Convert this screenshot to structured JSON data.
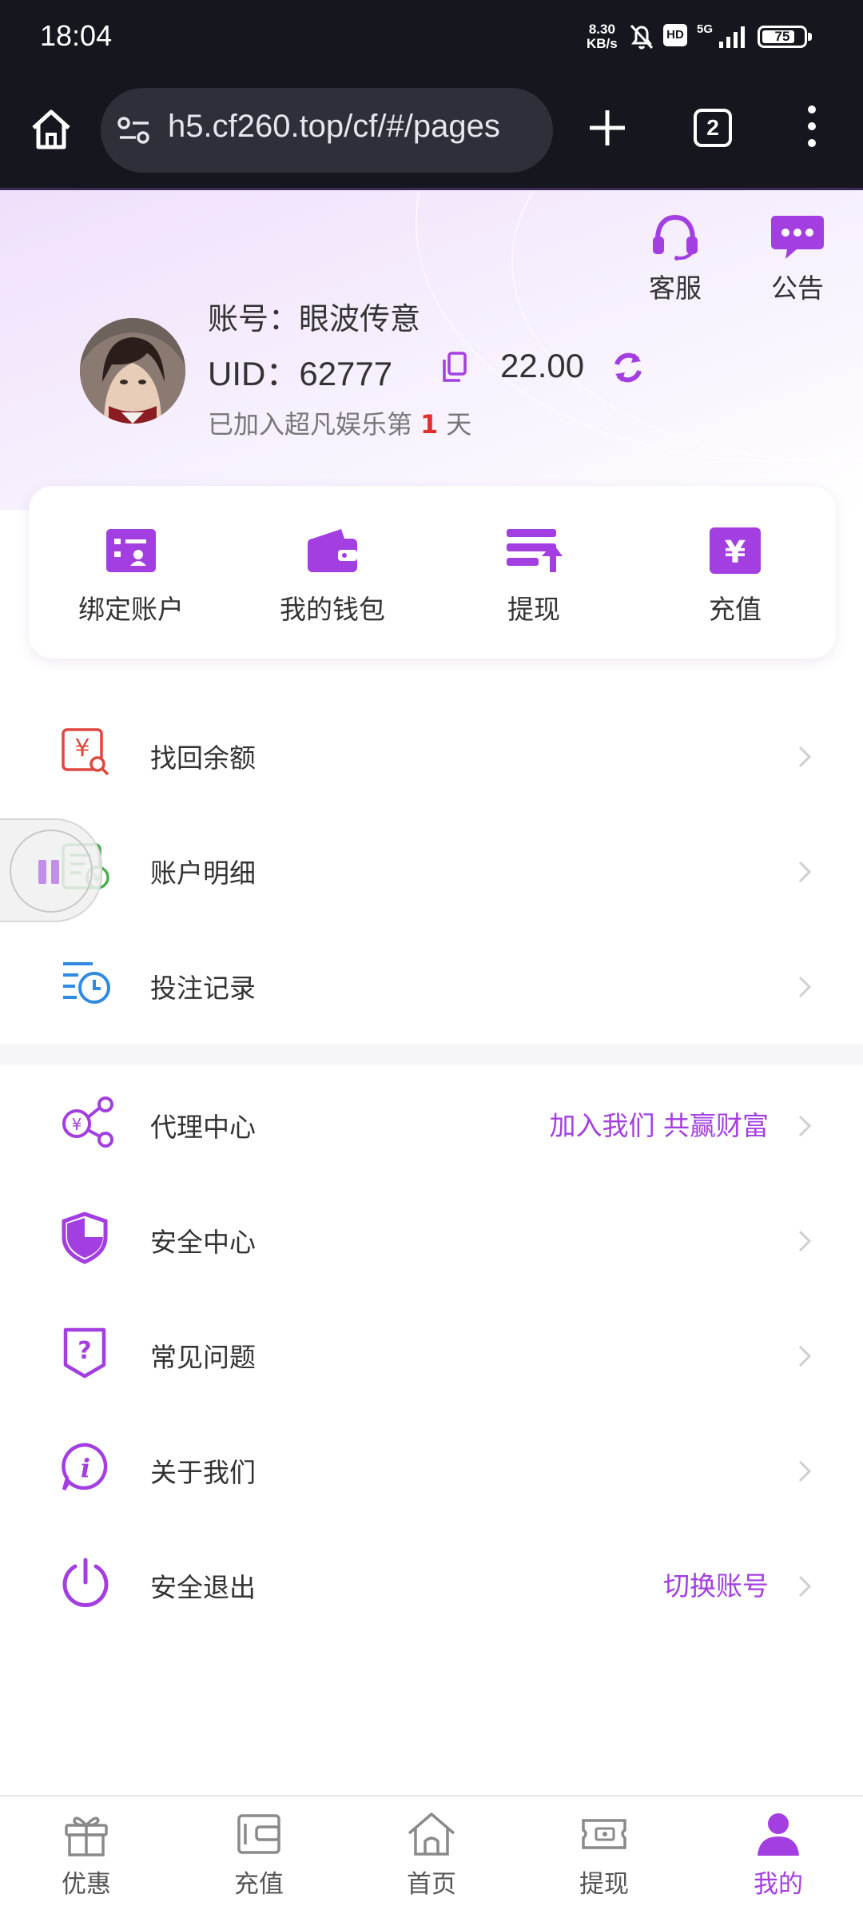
{
  "status_bar": {
    "time": "18:04",
    "net_speed_value": "8.30",
    "net_speed_unit": "KB/s",
    "hd_badge": "HD",
    "network": "5G",
    "battery": "75"
  },
  "browser": {
    "url": "h5.cf260.top/cf/#/pages",
    "tab_count": "2"
  },
  "header": {
    "support_label": "客服",
    "notice_label": "公告",
    "account_text": "账号：眼波传意",
    "uid_text": "UID：62777",
    "balance": "22.00",
    "joined_prefix": "已加入超凡娱乐第",
    "joined_days": "1",
    "joined_suffix": "天"
  },
  "quick_actions": [
    {
      "label": "绑定账户",
      "icon": "bind-account-icon"
    },
    {
      "label": "我的钱包",
      "icon": "wallet-icon"
    },
    {
      "label": "提现",
      "icon": "withdraw-icon"
    },
    {
      "label": "充值",
      "icon": "recharge-icon"
    }
  ],
  "menu_group_1": [
    {
      "label": "找回余额",
      "icon": "recover-balance-icon",
      "extra": ""
    },
    {
      "label": "账户明细",
      "icon": "account-details-icon",
      "extra": ""
    },
    {
      "label": "投注记录",
      "icon": "bet-records-icon",
      "extra": ""
    }
  ],
  "menu_group_2": [
    {
      "label": "代理中心",
      "icon": "agent-share-icon",
      "extra": "加入我们 共赢财富"
    },
    {
      "label": "安全中心",
      "icon": "shield-icon",
      "extra": ""
    },
    {
      "label": "常见问题",
      "icon": "question-icon",
      "extra": ""
    },
    {
      "label": "关于我们",
      "icon": "info-icon",
      "extra": ""
    },
    {
      "label": "安全退出",
      "icon": "power-icon",
      "extra": "切换账号"
    }
  ],
  "bottom_nav": [
    {
      "label": "优惠",
      "icon": "gift-icon",
      "active": false
    },
    {
      "label": "充值",
      "icon": "card-icon",
      "active": false
    },
    {
      "label": "首页",
      "icon": "home-icon",
      "active": false
    },
    {
      "label": "提现",
      "icon": "ticket-icon",
      "active": false
    },
    {
      "label": "我的",
      "icon": "user-icon",
      "active": true
    }
  ],
  "colors": {
    "accent": "#a33fe0",
    "highlight": "#e0302c"
  }
}
